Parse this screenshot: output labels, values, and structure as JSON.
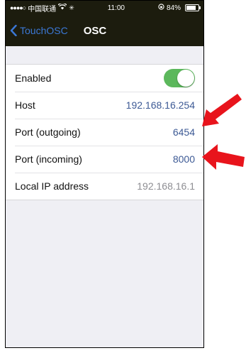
{
  "statusbar": {
    "signal": "●●●●○",
    "carrier": "中国联通",
    "time": "11:00",
    "battery_text": "84%",
    "battery_level": 0.84
  },
  "nav": {
    "back_label": "TouchOSC",
    "title": "OSC"
  },
  "settings": {
    "enabled_label": "Enabled",
    "enabled_on": true,
    "host_label": "Host",
    "host_value": "192.168.16.254",
    "port_out_label": "Port (outgoing)",
    "port_out_value": "6454",
    "port_in_label": "Port (incoming)",
    "port_in_value": "8000",
    "local_ip_label": "Local IP address",
    "local_ip_value": "192.168.16.1"
  },
  "colors": {
    "toggle_on": "#5cb85c",
    "link": "#3b78d6",
    "value": "#3d5a95",
    "arrow": "#e8141c"
  },
  "icons": [
    "wifi-icon",
    "lock-rotation-icon",
    "battery-icon",
    "chevron-left-icon",
    "red-arrow-icon"
  ]
}
